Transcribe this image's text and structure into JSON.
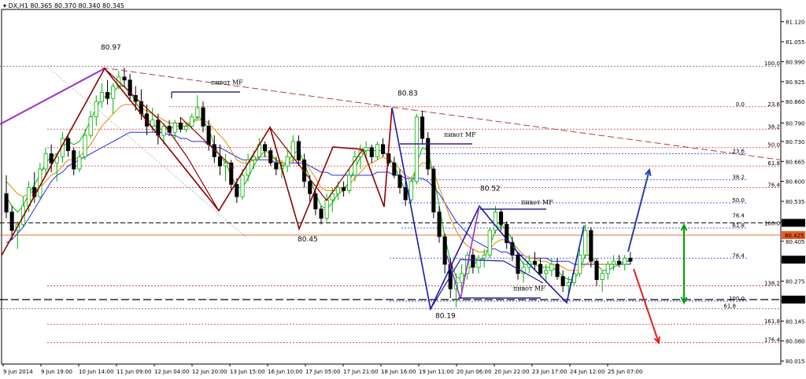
{
  "header": {
    "symbol_label": "DX,H1",
    "ohlc_text": "80.365 80.370 80.340 80.345"
  },
  "colors": {
    "bull": "#00b000",
    "bear": "#000000",
    "bg": "#ffffff",
    "zigzag": "#8b0000",
    "abcd": "#1a1aa8",
    "purple": "#9b30c8",
    "fib_red": "#c83232",
    "fib_blue": "#2a2aee",
    "ma_fast": "#00b400",
    "ma_mid": "#e08a00",
    "ma_slow": "#2a2aee",
    "arrow_up": "#2a3fb0",
    "arrow_down": "#e02020",
    "arrow_range": "#00a000"
  },
  "chart_data": {
    "type": "candlestick",
    "y_ticks": [
      "81.120",
      "81.055",
      "80.990",
      "80.925",
      "80.860",
      "80.790",
      "80.730",
      "80.665",
      "80.600",
      "80.535",
      "80.470",
      "80.405",
      "80.340",
      "80.275",
      "80.210",
      "80.145",
      "80.080",
      "80.015"
    ],
    "ylim": [
      80.005,
      81.16
    ],
    "x_ticks": [
      "9 Jun 2014",
      "9 Jun 19:00",
      "10 Jun 14:00",
      "11 Jun 09:00",
      "12 Jun 04:00",
      "12 Jun 20:00",
      "13 Jun 15:00",
      "16 Jun 10:00",
      "17 Jun 05:00",
      "17 Jun 21:00",
      "18 Jun 16:00",
      "19 Jun 11:00",
      "20 Jun 06:00",
      "20 Jun 22:00",
      "23 Jun 17:00",
      "24 Jun 12:00",
      "25 Jun 07:00"
    ],
    "price_markers": [
      {
        "value": 80.465,
        "text": "80.465",
        "style": "black"
      },
      {
        "value": 80.425,
        "text": "80.425",
        "style": "orange"
      },
      {
        "value": 80.345,
        "text": "80.345",
        "style": "black"
      },
      {
        "value": 80.215,
        "text": "80.215",
        "style": "black"
      }
    ],
    "candles": [
      [
        80.56,
        80.62,
        80.48,
        80.5
      ],
      [
        80.5,
        80.52,
        80.41,
        80.44
      ],
      [
        80.44,
        80.47,
        80.38,
        80.46
      ],
      [
        80.46,
        80.55,
        80.45,
        80.52
      ],
      [
        80.52,
        80.6,
        80.5,
        80.58
      ],
      [
        80.58,
        80.63,
        80.53,
        80.55
      ],
      [
        80.55,
        80.66,
        80.54,
        80.64
      ],
      [
        80.64,
        80.71,
        80.62,
        80.69
      ],
      [
        80.69,
        80.72,
        80.63,
        80.66
      ],
      [
        80.66,
        80.69,
        80.6,
        80.68
      ],
      [
        80.68,
        80.76,
        80.66,
        80.74
      ],
      [
        80.74,
        80.75,
        80.68,
        80.7
      ],
      [
        80.7,
        80.71,
        80.62,
        80.64
      ],
      [
        80.64,
        80.7,
        80.63,
        80.68
      ],
      [
        80.68,
        80.77,
        80.67,
        80.75
      ],
      [
        80.75,
        80.83,
        80.74,
        80.81
      ],
      [
        80.81,
        80.88,
        80.78,
        80.86
      ],
      [
        80.86,
        80.92,
        80.84,
        80.89
      ],
      [
        80.89,
        80.93,
        80.85,
        80.87
      ],
      [
        80.87,
        80.92,
        80.82,
        80.91
      ],
      [
        80.91,
        80.96,
        80.9,
        80.94
      ],
      [
        80.94,
        80.97,
        80.91,
        80.93
      ],
      [
        80.93,
        80.95,
        80.86,
        80.88
      ],
      [
        80.88,
        80.91,
        80.83,
        80.86
      ],
      [
        80.86,
        80.9,
        80.8,
        80.82
      ],
      [
        80.82,
        80.85,
        80.75,
        80.78
      ],
      [
        80.78,
        80.84,
        80.76,
        80.8
      ],
      [
        80.8,
        80.82,
        80.72,
        80.75
      ],
      [
        80.75,
        80.79,
        80.72,
        80.78
      ],
      [
        80.78,
        80.8,
        80.75,
        80.76
      ],
      [
        80.76,
        80.8,
        80.74,
        80.79
      ],
      [
        80.79,
        80.81,
        80.76,
        80.77
      ],
      [
        80.77,
        80.79,
        80.76,
        80.78
      ],
      [
        80.78,
        80.82,
        80.77,
        80.81
      ],
      [
        80.81,
        80.88,
        80.8,
        80.84
      ],
      [
        80.84,
        80.86,
        80.76,
        80.78
      ],
      [
        80.78,
        80.8,
        80.7,
        80.72
      ],
      [
        80.72,
        80.75,
        80.66,
        80.68
      ],
      [
        80.68,
        80.72,
        80.62,
        80.65
      ],
      [
        80.65,
        80.69,
        80.6,
        80.66
      ],
      [
        80.66,
        80.67,
        80.57,
        80.59
      ],
      [
        80.59,
        80.61,
        80.53,
        80.55
      ],
      [
        80.55,
        80.64,
        80.54,
        80.62
      ],
      [
        80.62,
        80.69,
        80.6,
        80.67
      ],
      [
        80.67,
        80.7,
        80.64,
        80.68
      ],
      [
        80.68,
        80.74,
        80.67,
        80.72
      ],
      [
        80.72,
        80.73,
        80.68,
        80.7
      ],
      [
        80.7,
        80.71,
        80.65,
        80.66
      ],
      [
        80.66,
        80.68,
        80.62,
        80.64
      ],
      [
        80.64,
        80.67,
        80.61,
        80.65
      ],
      [
        80.65,
        80.7,
        80.63,
        80.68
      ],
      [
        80.68,
        80.75,
        80.66,
        80.73
      ],
      [
        80.73,
        80.75,
        80.65,
        80.67
      ],
      [
        80.67,
        80.69,
        80.58,
        80.6
      ],
      [
        80.6,
        80.62,
        80.53,
        80.56
      ],
      [
        80.56,
        80.57,
        80.49,
        80.51
      ],
      [
        80.51,
        80.52,
        80.46,
        80.48
      ],
      [
        80.48,
        80.56,
        80.47,
        80.54
      ],
      [
        80.54,
        80.58,
        80.5,
        80.56
      ],
      [
        80.56,
        80.6,
        80.54,
        80.58
      ],
      [
        80.58,
        80.6,
        80.55,
        80.57
      ],
      [
        80.57,
        80.64,
        80.56,
        80.62
      ],
      [
        80.62,
        80.7,
        80.6,
        80.68
      ],
      [
        80.68,
        80.72,
        80.64,
        80.7
      ],
      [
        80.7,
        80.73,
        80.67,
        80.71
      ],
      [
        80.71,
        80.72,
        80.66,
        80.68
      ],
      [
        80.68,
        80.73,
        80.67,
        80.72
      ],
      [
        80.72,
        80.74,
        80.68,
        80.69
      ],
      [
        80.69,
        80.71,
        80.65,
        80.66
      ],
      [
        80.66,
        80.68,
        80.61,
        80.62
      ],
      [
        80.62,
        80.64,
        80.56,
        80.58
      ],
      [
        80.58,
        80.6,
        80.52,
        80.54
      ],
      [
        80.54,
        80.61,
        80.53,
        80.6
      ],
      [
        80.6,
        80.82,
        80.59,
        80.81
      ],
      [
        80.81,
        80.83,
        80.72,
        80.74
      ],
      [
        80.74,
        80.76,
        80.62,
        80.64
      ],
      [
        80.64,
        80.65,
        80.48,
        80.5
      ],
      [
        80.5,
        80.52,
        80.4,
        80.42
      ],
      [
        80.42,
        80.43,
        80.3,
        80.33
      ],
      [
        80.33,
        80.35,
        80.22,
        80.25
      ],
      [
        80.25,
        80.3,
        80.19,
        80.27
      ],
      [
        80.27,
        80.33,
        80.24,
        80.3
      ],
      [
        80.3,
        80.37,
        80.28,
        80.36
      ],
      [
        80.36,
        80.38,
        80.3,
        80.32
      ],
      [
        80.32,
        80.36,
        80.3,
        80.35
      ],
      [
        80.35,
        80.38,
        80.32,
        80.36
      ],
      [
        80.36,
        80.45,
        80.35,
        80.44
      ],
      [
        80.44,
        80.52,
        80.43,
        80.5
      ],
      [
        80.5,
        80.51,
        80.44,
        80.46
      ],
      [
        80.46,
        80.47,
        80.38,
        80.4
      ],
      [
        80.4,
        80.42,
        80.34,
        80.36
      ],
      [
        80.36,
        80.37,
        80.28,
        80.3
      ],
      [
        80.3,
        80.34,
        80.27,
        80.32
      ],
      [
        80.32,
        80.36,
        80.3,
        80.34
      ],
      [
        80.34,
        80.37,
        80.31,
        80.33
      ],
      [
        80.33,
        80.35,
        80.29,
        80.3
      ],
      [
        80.3,
        80.33,
        80.27,
        80.31
      ],
      [
        80.31,
        80.35,
        80.29,
        80.33
      ],
      [
        80.33,
        80.35,
        80.28,
        80.29
      ],
      [
        80.29,
        80.31,
        80.24,
        80.26
      ],
      [
        80.26,
        80.29,
        80.23,
        80.27
      ],
      [
        80.27,
        80.31,
        80.26,
        80.3
      ],
      [
        80.3,
        80.38,
        80.29,
        80.36
      ],
      [
        80.36,
        80.46,
        80.35,
        80.44
      ],
      [
        80.44,
        80.45,
        80.32,
        80.34
      ],
      [
        80.34,
        80.35,
        80.26,
        80.28
      ],
      [
        80.28,
        80.31,
        80.24,
        80.3
      ],
      [
        80.3,
        80.34,
        80.28,
        80.33
      ],
      [
        80.33,
        80.36,
        80.31,
        80.34
      ],
      [
        80.34,
        80.36,
        80.32,
        80.33
      ],
      [
        80.33,
        80.36,
        80.31,
        80.35
      ],
      [
        80.35,
        80.37,
        80.33,
        80.34
      ]
    ],
    "ma_fast": [
      80.55,
      80.52,
      80.5,
      80.52,
      80.56,
      80.59,
      80.62,
      80.66,
      80.68,
      80.69,
      80.71,
      80.73,
      80.72,
      80.73,
      80.76,
      80.8,
      80.84,
      80.87,
      80.88,
      80.89,
      80.91,
      80.91,
      80.89,
      80.86,
      80.83,
      80.8,
      80.79,
      80.77,
      80.77,
      80.77,
      80.78,
      80.78,
      80.78,
      80.79,
      80.81,
      80.8,
      80.77,
      80.72,
      80.68,
      80.66,
      80.62,
      80.58,
      80.58,
      80.61,
      80.65,
      80.68,
      80.7,
      80.69,
      80.67,
      80.65,
      80.66,
      80.69,
      80.7,
      80.66,
      80.61,
      80.56,
      80.52,
      80.51,
      80.53,
      80.56,
      80.57,
      80.6,
      80.64,
      80.68,
      80.7,
      80.7,
      80.7,
      80.7,
      80.68,
      80.65,
      80.61,
      80.57,
      80.57,
      80.66,
      80.71,
      80.7,
      80.62,
      80.52,
      80.42,
      80.34,
      80.29,
      80.28,
      80.31,
      80.33,
      80.34,
      80.35,
      80.39,
      80.44,
      80.46,
      80.44,
      80.41,
      80.36,
      80.33,
      80.33,
      80.33,
      80.32,
      80.32,
      80.32,
      80.31,
      80.29,
      80.28,
      80.28,
      80.31,
      80.36,
      80.36,
      80.33,
      80.31,
      80.31,
      80.32,
      80.33,
      80.34,
      80.34
    ],
    "ma_mid": [
      80.6,
      80.58,
      80.56,
      80.55,
      80.56,
      80.57,
      80.58,
      80.6,
      80.62,
      80.63,
      80.65,
      80.67,
      80.67,
      80.68,
      80.7,
      80.72,
      80.75,
      80.78,
      80.8,
      80.82,
      80.84,
      80.85,
      80.85,
      80.85,
      80.84,
      80.83,
      80.82,
      80.81,
      80.8,
      80.79,
      80.79,
      80.79,
      80.79,
      80.79,
      80.8,
      80.8,
      80.79,
      80.77,
      80.75,
      80.73,
      80.7,
      80.67,
      80.66,
      80.66,
      80.67,
      80.68,
      80.68,
      80.68,
      80.67,
      80.66,
      80.66,
      80.67,
      80.67,
      80.66,
      80.64,
      80.61,
      80.58,
      80.57,
      80.57,
      80.57,
      80.58,
      80.59,
      80.61,
      80.63,
      80.65,
      80.66,
      80.67,
      80.68,
      80.67,
      80.66,
      80.64,
      80.62,
      80.61,
      80.64,
      80.66,
      80.66,
      80.63,
      80.58,
      80.53,
      80.48,
      80.44,
      80.41,
      80.39,
      80.38,
      80.37,
      80.37,
      80.38,
      80.4,
      80.41,
      80.41,
      80.4,
      80.38,
      80.36,
      80.35,
      80.35,
      80.34,
      80.34,
      80.33,
      80.33,
      80.32,
      80.31,
      80.31,
      80.31,
      80.33,
      80.34,
      80.33,
      80.33,
      80.33,
      80.33,
      80.33,
      80.34,
      80.34
    ],
    "ma_slow": [
      80.4,
      80.41,
      80.43,
      80.45,
      80.48,
      80.51,
      80.54,
      80.57,
      80.6,
      80.62,
      80.63,
      80.65,
      80.66,
      80.67,
      80.68,
      80.69,
      80.7,
      80.71,
      80.72,
      80.73,
      80.74,
      80.75,
      80.76,
      80.76,
      80.76,
      80.76,
      80.76,
      80.76,
      80.76,
      80.75,
      80.75,
      80.74,
      80.74,
      80.73,
      80.73,
      80.73,
      80.72,
      80.71,
      80.71,
      80.7,
      80.69,
      80.68,
      80.67,
      80.67,
      80.67,
      80.67,
      80.67,
      80.67,
      80.66,
      80.66,
      80.66,
      80.66,
      80.66,
      80.66,
      80.65,
      80.64,
      80.63,
      80.63,
      80.62,
      80.62,
      80.62,
      80.62,
      80.62,
      80.62,
      80.62,
      80.62,
      80.63,
      80.63,
      80.63,
      80.62,
      80.62,
      80.61,
      80.61,
      80.61,
      80.61,
      80.6,
      80.58,
      80.56,
      80.53,
      80.5,
      80.47,
      80.45,
      80.43,
      80.41,
      80.4,
      80.39,
      80.38,
      80.38,
      80.37,
      80.37,
      80.36,
      80.36,
      80.36,
      80.35,
      80.35,
      80.35,
      80.35,
      80.34,
      80.34,
      80.34,
      80.34,
      80.33,
      80.33,
      80.33,
      80.33,
      80.33,
      80.33,
      80.33,
      80.33,
      80.33,
      80.33,
      80.33
    ]
  },
  "fib_labels": [
    {
      "text": "100.0",
      "value": 80.975,
      "color": "red"
    },
    {
      "text": "0.0",
      "value": 80.843,
      "color": "blue"
    },
    {
      "text": "23.6",
      "value": 80.843,
      "color": "red"
    },
    {
      "text": "38.2",
      "value": 80.77,
      "color": "red"
    },
    {
      "text": "50.0",
      "value": 80.71,
      "color": "red"
    },
    {
      "text": "23.6",
      "value": 80.69,
      "color": "blue"
    },
    {
      "text": "61.8",
      "value": 80.65,
      "color": "red"
    },
    {
      "text": "38.2",
      "value": 80.605,
      "color": "blue"
    },
    {
      "text": "76.4",
      "value": 80.58,
      "color": "red"
    },
    {
      "text": "50.0",
      "value": 80.53,
      "color": "blue"
    },
    {
      "text": "76.4",
      "value": 80.48,
      "color": "blue"
    },
    {
      "text": "100.0",
      "value": 80.455,
      "color": "red"
    },
    {
      "text": "61.8",
      "value": 80.448,
      "color": "blue"
    },
    {
      "text": "76.4",
      "value": 80.35,
      "color": "blue"
    },
    {
      "text": "138.2",
      "value": 80.26,
      "color": "red"
    },
    {
      "text": "100.0",
      "value": 80.21,
      "color": "blue"
    },
    {
      "text": "61.8",
      "value": 80.185,
      "color": "black"
    },
    {
      "text": "161.8",
      "value": 80.135,
      "color": "red"
    },
    {
      "text": "176.4",
      "value": 80.075,
      "color": "red"
    }
  ],
  "annotations": [
    {
      "text": "80.97",
      "x": 128,
      "value": 81.03
    },
    {
      "text": "80.83",
      "x": 505,
      "value": 80.88
    },
    {
      "text": "80.52",
      "x": 610,
      "value": 80.57
    },
    {
      "text": "80.45",
      "x": 378,
      "value": 80.405
    },
    {
      "text": "80.19",
      "x": 553,
      "value": 80.155
    }
  ],
  "pivot_labels": [
    {
      "text": "пивот MF",
      "x": 268,
      "value": 80.915
    },
    {
      "text": "пивот MF",
      "x": 564,
      "value": 80.745
    },
    {
      "text": "пивот MF",
      "x": 662,
      "value": 80.525
    },
    {
      "text": "пивот MF",
      "x": 652,
      "value": 80.245
    }
  ]
}
